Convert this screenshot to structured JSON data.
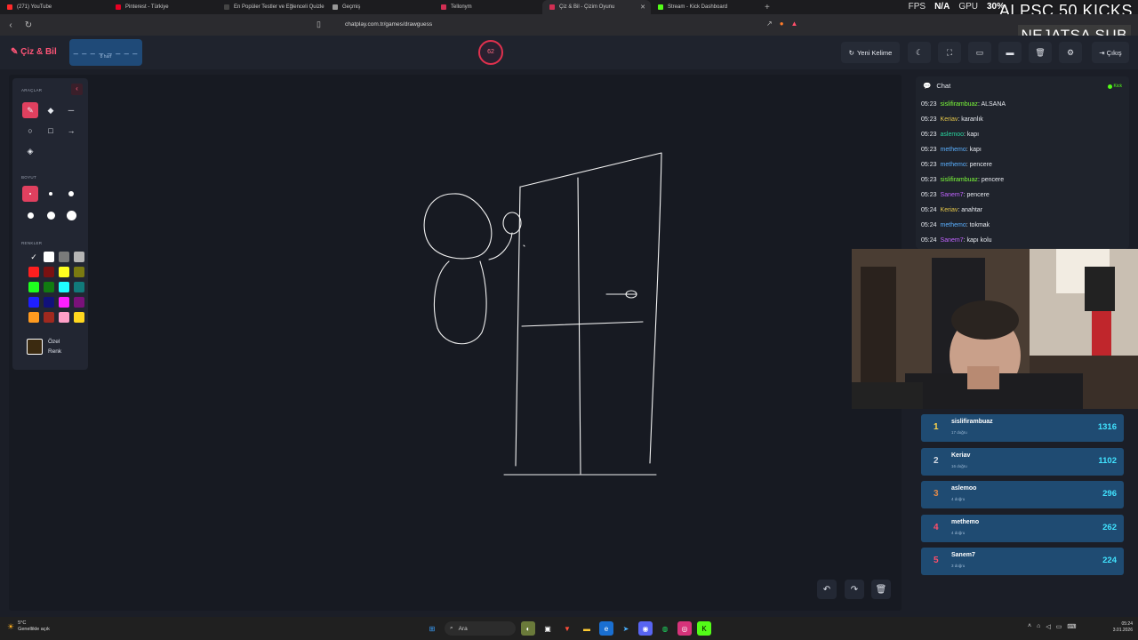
{
  "browser": {
    "tabs": [
      {
        "title": "(271) YouTube",
        "color": "#ff2a2a"
      },
      {
        "title": "Pinterest - Türkiye",
        "color": "#e60023"
      },
      {
        "title": "En Popüler Testler ve Eğlenceli Quizle",
        "color": "#444444"
      },
      {
        "title": "Geçmiş",
        "color": "#999999"
      },
      {
        "title": "Tellonym",
        "color": "#d12f53"
      },
      {
        "title": "Çiz & Bil - Çizim Oyunu",
        "color": "#d12f53"
      },
      {
        "title": "Stream - Kick Dashboard",
        "color": "#53fc18"
      }
    ],
    "active_tab_index": 5,
    "url": "chatplay.com.tr/games/drawguess",
    "fps_label": "FPS",
    "fps_value": "N/A",
    "gpu_label": "GPU",
    "gpu_value": "30%"
  },
  "stream_overlay": {
    "kicks_text": "ALPSC 50 KICKS",
    "sub_text": "NEJATSA SUB"
  },
  "header": {
    "logo": "Çiz & Bil",
    "word_mask": "_ _ _ _ _ _ _ _",
    "word_hint": "8 harf",
    "timer": "62",
    "new_word_label": "Yeni Kelime",
    "logout_label": "Çıkış"
  },
  "tools": {
    "title": "ARAÇLAR",
    "size_title": "BOYUT",
    "colors_title": "RENKLER",
    "custom_color_label_1": "Özel",
    "custom_color_label_2": "Renk",
    "colors": [
      "#000000",
      "#ffffff",
      "#7a7a7a",
      "#b5b5b5",
      "#ff1f1f",
      "#7a1111",
      "#ffff1f",
      "#7a7a11",
      "#1fff1f",
      "#117a11",
      "#1fffff",
      "#117a7a",
      "#1f1fff",
      "#11117a",
      "#ff1fff",
      "#7a117a",
      "#ff9a1f",
      "#a0291f",
      "#ffa0c8",
      "#ffd71f"
    ],
    "selected_color_index": 0,
    "accent": "#e0405f"
  },
  "chat": {
    "title": "Chat",
    "source": "Kick",
    "messages": [
      {
        "time": "05:23",
        "user": "sislifirambuaz",
        "color": "#7cfc3a",
        "text": "ALSANA"
      },
      {
        "time": "05:23",
        "user": "Keriav",
        "color": "#e6c84a",
        "text": "karanlık"
      },
      {
        "time": "05:23",
        "user": "aslemoo",
        "color": "#2ad6a0",
        "text": "kapı"
      },
      {
        "time": "05:23",
        "user": "methemo",
        "color": "#5ab0ff",
        "text": "kapı"
      },
      {
        "time": "05:23",
        "user": "methemo",
        "color": "#5ab0ff",
        "text": "pencere"
      },
      {
        "time": "05:23",
        "user": "sislifirambuaz",
        "color": "#7cfc3a",
        "text": "pencere"
      },
      {
        "time": "05:23",
        "user": "Sanem7",
        "color": "#c064ff",
        "text": "pencere"
      },
      {
        "time": "05:24",
        "user": "Keriav",
        "color": "#e6c84a",
        "text": "anahtar"
      },
      {
        "time": "05:24",
        "user": "methemo",
        "color": "#5ab0ff",
        "text": "tokmak"
      },
      {
        "time": "05:24",
        "user": "Sanem7",
        "color": "#c064ff",
        "text": "kapı kolu"
      }
    ]
  },
  "leaderboard": [
    {
      "rank": "1",
      "name": "sislifirambuaz",
      "sub": "17 doğru",
      "score": "1316",
      "rank_color": "#ffd54a"
    },
    {
      "rank": "2",
      "name": "Keriav",
      "sub": "16 doğru",
      "score": "1102",
      "rank_color": "#d6dbe4"
    },
    {
      "rank": "3",
      "name": "aslemoo",
      "sub": "4 doğru",
      "score": "296",
      "rank_color": "#e08a4a"
    },
    {
      "rank": "4",
      "name": "methemo",
      "sub": "4 doğru",
      "score": "262",
      "rank_color": "#ff4e6a"
    },
    {
      "rank": "5",
      "name": "Sanem7",
      "sub": "3 doğru",
      "score": "224",
      "rank_color": "#ff4e6a"
    }
  ],
  "taskbar": {
    "weather_temp": "5°C",
    "weather_desc": "Genellikle açık",
    "search_label": "Ara",
    "time": "05:24",
    "date": "3.01.2026"
  }
}
